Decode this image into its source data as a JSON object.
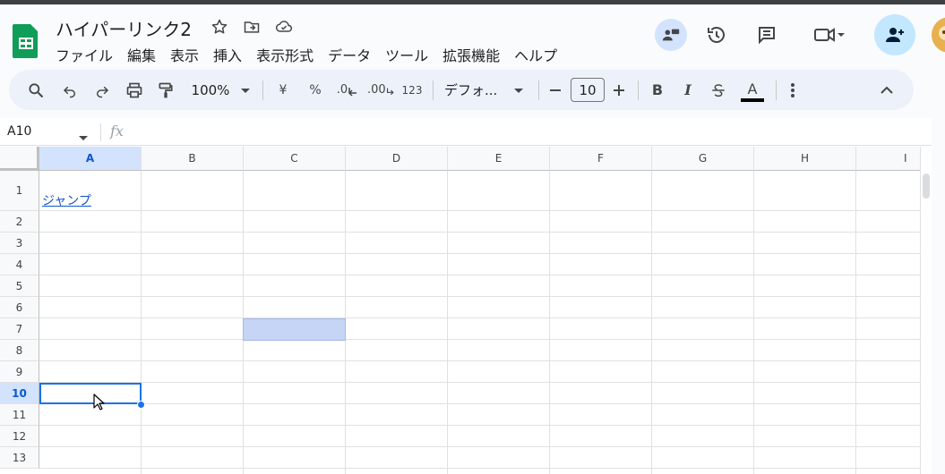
{
  "document": {
    "title": "ハイパーリンク2"
  },
  "menu": [
    "ファイル",
    "編集",
    "表示",
    "挿入",
    "表示形式",
    "データ",
    "ツール",
    "拡張機能",
    "ヘルプ"
  ],
  "toolbar": {
    "zoom": "100%",
    "currency": "¥",
    "percent": "%",
    "decimal_decrease": ".0",
    "decimal_increase": ".00",
    "number_format": "123",
    "font": "デフォ...",
    "font_size": "10",
    "bold": "B",
    "italic": "I",
    "text_color_letter": "A"
  },
  "formula_bar": {
    "cell_ref": "A10",
    "fx": "fx",
    "value": ""
  },
  "columns": [
    "A",
    "B",
    "C",
    "D",
    "E",
    "F",
    "G",
    "H",
    "I"
  ],
  "rows": [
    "1",
    "2",
    "3",
    "4",
    "5",
    "6",
    "7",
    "8",
    "9",
    "10",
    "11",
    "12",
    "13"
  ],
  "cells": {
    "A1": "ジャンプ"
  },
  "colors": {
    "accent": "#1a73e8",
    "link": "#1155cc",
    "sheets_green": "#0f9d58",
    "selection": "#c6d5f5"
  }
}
